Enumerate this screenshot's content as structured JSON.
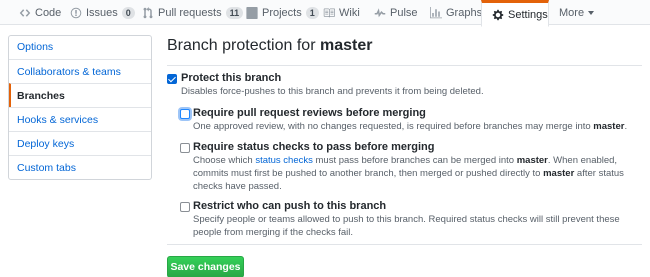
{
  "reponav": {
    "tabs": [
      {
        "label": "Code",
        "icon": "code-icon"
      },
      {
        "label": "Issues",
        "icon": "issue-icon",
        "count": "0"
      },
      {
        "label": "Pull requests",
        "icon": "pull-request-icon",
        "count": "11"
      },
      {
        "label": "Projects",
        "icon": "project-icon",
        "count": "1"
      },
      {
        "label": "Wiki",
        "icon": "book-icon"
      },
      {
        "label": "Pulse",
        "icon": "pulse-icon"
      },
      {
        "label": "Graphs",
        "icon": "graph-icon"
      },
      {
        "label": "Settings",
        "icon": "gear-icon",
        "selected": true
      },
      {
        "label": "More",
        "icon": "chevron-down-icon"
      }
    ]
  },
  "sidebar": {
    "items": [
      {
        "label": "Options"
      },
      {
        "label": "Collaborators & teams"
      },
      {
        "label": "Branches",
        "selected": true
      },
      {
        "label": "Hooks & services"
      },
      {
        "label": "Deploy keys"
      },
      {
        "label": "Custom tabs"
      }
    ]
  },
  "main": {
    "title_prefix": "Branch protection for",
    "branch": "master",
    "protect": {
      "checked": true,
      "label": "Protect this branch",
      "note": "Disables force-pushes to this branch and prevents it from being deleted."
    },
    "reviews": {
      "checked": false,
      "label": "Require pull request reviews before merging",
      "note_text": "One approved review, with no changes requested, is required before branches may merge into",
      "note_branch": "master",
      "note_end": "."
    },
    "status_checks": {
      "checked": false,
      "label": "Require status checks to pass before merging",
      "note_a": "Choose which",
      "note_link": "status checks",
      "note_b": "must pass before branches can be merged into",
      "note_branch": "master",
      "note_c": ". When enabled, commits must first be pushed to another branch, then merged or pushed directly to",
      "note_branch2": "master",
      "note_d": "after status checks have passed."
    },
    "restrict": {
      "checked": false,
      "label": "Restrict who can push to this branch",
      "note": "Specify people or teams allowed to push to this branch. Required status checks will still prevent these people from merging if the checks fail."
    },
    "save_label": "Save changes"
  },
  "colors": {
    "accent": "#e36209",
    "link": "#0366d6",
    "save_button": "#28a745",
    "checkbox_checked": "#0366d6"
  }
}
